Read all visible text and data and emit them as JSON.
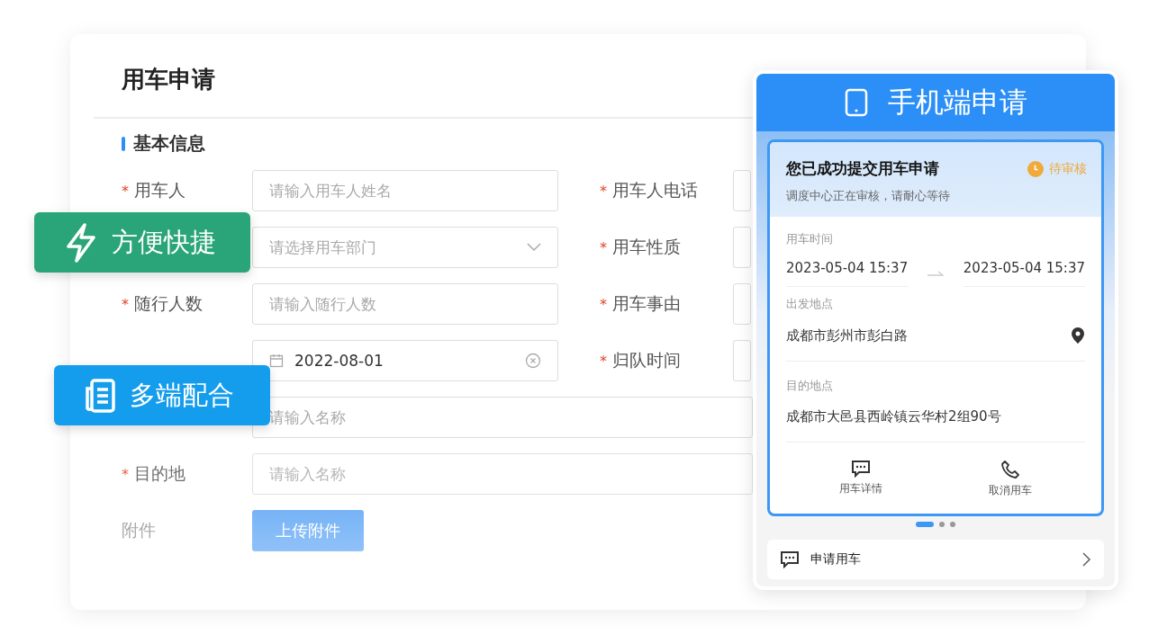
{
  "form": {
    "title": "用车申请",
    "section": "基本信息",
    "rows": [
      {
        "label": "用车人",
        "mark": "*",
        "kind": "text",
        "placeholder": "请输入用车人姓名",
        "right": {
          "label": "用车人电话",
          "mark": "*"
        }
      },
      {
        "kind": "select",
        "placeholder": "请选择用车部门",
        "right": {
          "label": "用车性质",
          "mark": "*"
        }
      },
      {
        "label": "随行人数",
        "mark": "*",
        "kind": "text",
        "placeholder": "请输入随行人数",
        "right": {
          "label": "用车事由",
          "mark": "*"
        }
      },
      {
        "kind": "date",
        "value": "2022-08-01",
        "right": {
          "label": "归队时间",
          "mark": "*"
        }
      },
      {
        "kind": "wide",
        "placeholder": "请输入名称"
      },
      {
        "label": "目的地",
        "mark": "*",
        "kind": "wide",
        "placeholder": "请输入名称"
      },
      {
        "label": "附件",
        "kind": "upload",
        "button": "上传附件"
      }
    ]
  },
  "badges": [
    {
      "text": "方便快捷",
      "kind": "bolt",
      "color": "#2aa57a"
    },
    {
      "text": "多端配合",
      "kind": "document",
      "color": "#149ced"
    }
  ],
  "phone": {
    "title": "手机端申请",
    "card": {
      "title": "您已成功提交用车申请",
      "status": "待审核",
      "subtitle": "调度中心正在审核，请耐心等待",
      "time_label": "用车时间",
      "start": "2023-05-04 15:37",
      "end": "2023-05-04 15:37",
      "from_label": "出发地点",
      "from": "成都市彭州市彭白路",
      "to_label": "目的地点",
      "to": "成都市大邑县西岭镇云华村2组90号",
      "actions": [
        {
          "label": "用车详情",
          "kind": "chat"
        },
        {
          "label": "取消用车",
          "kind": "phone"
        }
      ]
    },
    "pager": [
      {
        "selected": true
      },
      {
        "selected": false
      },
      {
        "selected": false
      }
    ],
    "footer": "申请用车"
  }
}
